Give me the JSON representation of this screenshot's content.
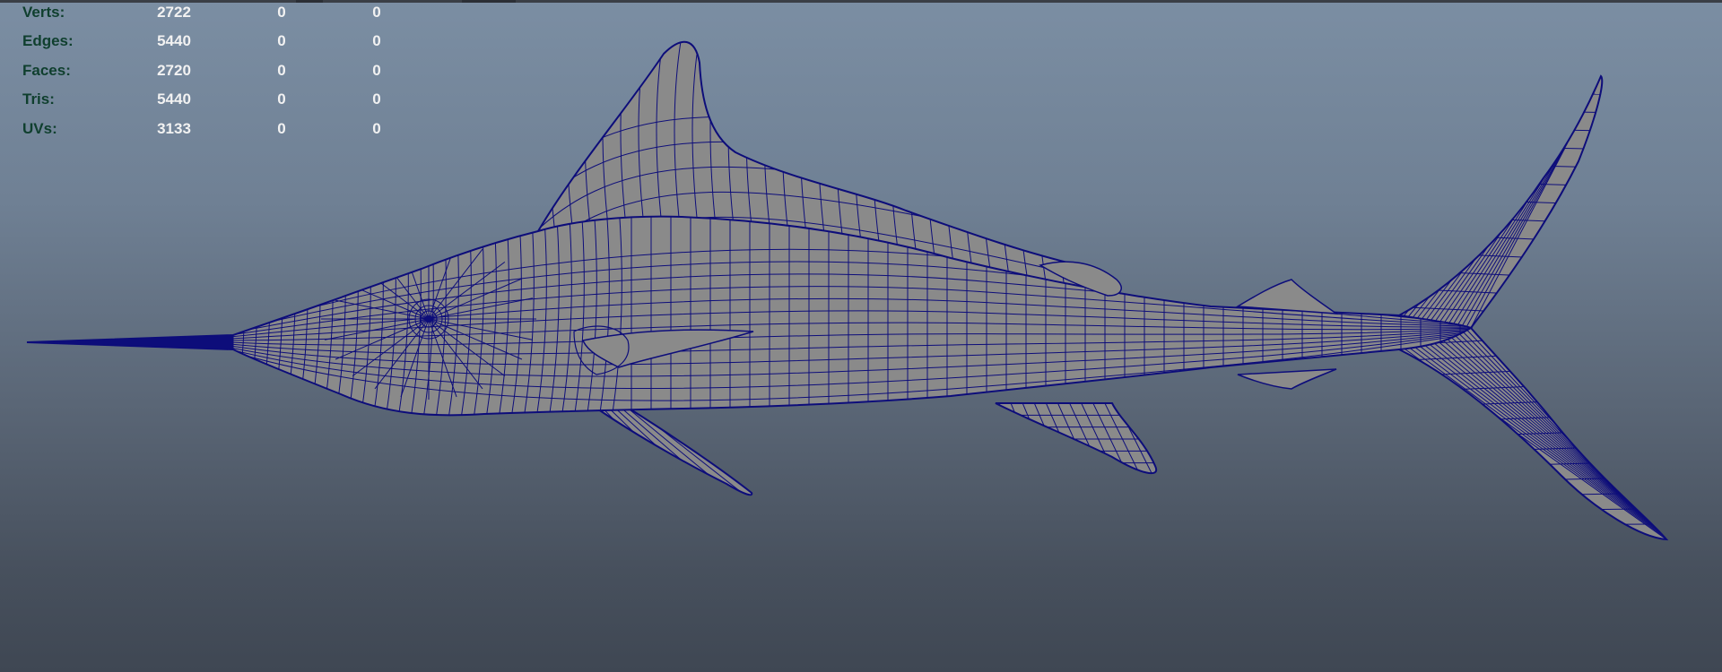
{
  "hud": {
    "rows": [
      {
        "label": "Verts:",
        "values": [
          "2722",
          "0",
          "0"
        ]
      },
      {
        "label": "Edges:",
        "values": [
          "5440",
          "0",
          "0"
        ]
      },
      {
        "label": "Faces:",
        "values": [
          "2720",
          "0",
          "0"
        ]
      },
      {
        "label": "Tris:",
        "values": [
          "5440",
          "0",
          "0"
        ]
      },
      {
        "label": "UVs:",
        "values": [
          "3133",
          "0",
          "0"
        ]
      }
    ]
  },
  "colors": {
    "wire": "#0d0d7a",
    "body": "#8a8a8a",
    "label": "#0f3f2e",
    "value": "#f2f2f2"
  }
}
